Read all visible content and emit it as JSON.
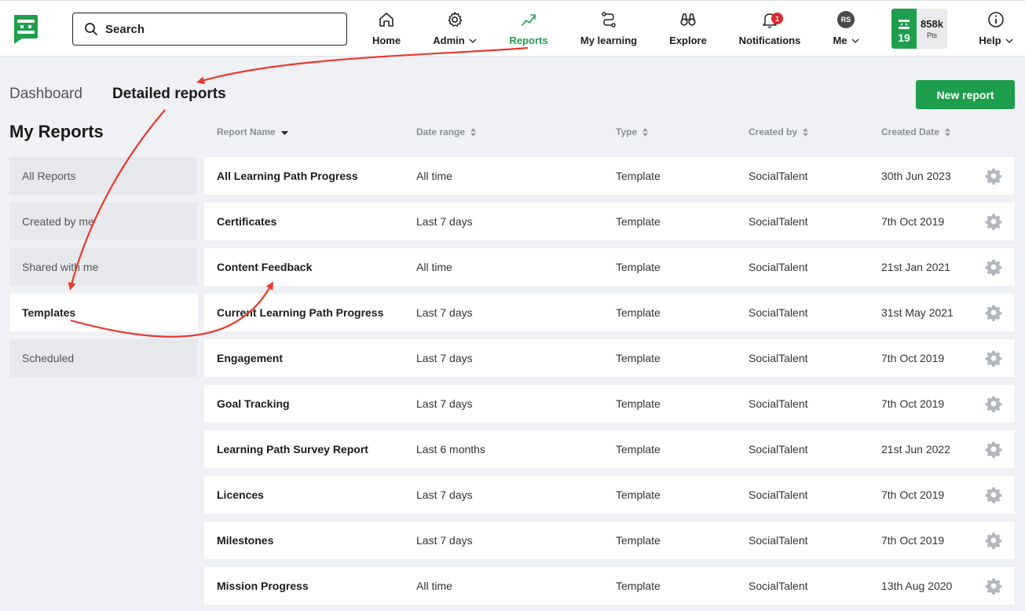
{
  "colors": {
    "brand_green": "#1f9e4d",
    "badge_red": "#e0262f",
    "annotation_red": "#e8392e"
  },
  "search": {
    "placeholder": "Search"
  },
  "nav": {
    "home": "Home",
    "admin": "Admin",
    "reports": "Reports",
    "learning": "My learning",
    "explore": "Explore",
    "notifications": "Notifications",
    "notifications_count": "1",
    "me": "Me",
    "me_initials": "RS",
    "help": "Help"
  },
  "points": {
    "level": "19",
    "value": "858k",
    "label": "Pts"
  },
  "tabs": {
    "dashboard": "Dashboard",
    "detailed": "Detailed reports"
  },
  "new_report_label": "New report",
  "sidebar": {
    "title": "My Reports",
    "items": [
      {
        "label": "All Reports"
      },
      {
        "label": "Created by me"
      },
      {
        "label": "Shared with me"
      },
      {
        "label": "Templates"
      },
      {
        "label": "Scheduled"
      }
    ]
  },
  "table": {
    "headers": {
      "name": "Report Name",
      "date": "Date range",
      "type": "Type",
      "by": "Created by",
      "created": "Created Date"
    },
    "rows": [
      {
        "name": "All Learning Path Progress",
        "date": "All time",
        "type": "Template",
        "by": "SocialTalent",
        "created": "30th Jun 2023"
      },
      {
        "name": "Certificates",
        "date": "Last 7 days",
        "type": "Template",
        "by": "SocialTalent",
        "created": "7th Oct 2019"
      },
      {
        "name": "Content Feedback",
        "date": "All time",
        "type": "Template",
        "by": "SocialTalent",
        "created": "21st Jan 2021"
      },
      {
        "name": "Current Learning Path Progress",
        "date": "Last 7 days",
        "type": "Template",
        "by": "SocialTalent",
        "created": "31st May 2021"
      },
      {
        "name": "Engagement",
        "date": "Last 7 days",
        "type": "Template",
        "by": "SocialTalent",
        "created": "7th Oct 2019"
      },
      {
        "name": "Goal Tracking",
        "date": "Last 7 days",
        "type": "Template",
        "by": "SocialTalent",
        "created": "7th Oct 2019"
      },
      {
        "name": "Learning Path Survey Report",
        "date": "Last 6 months",
        "type": "Template",
        "by": "SocialTalent",
        "created": "21st Jun 2022"
      },
      {
        "name": "Licences",
        "date": "Last 7 days",
        "type": "Template",
        "by": "SocialTalent",
        "created": "7th Oct 2019"
      },
      {
        "name": "Milestones",
        "date": "Last 7 days",
        "type": "Template",
        "by": "SocialTalent",
        "created": "7th Oct 2019"
      },
      {
        "name": "Mission Progress",
        "date": "All time",
        "type": "Template",
        "by": "SocialTalent",
        "created": "13th Aug 2020"
      }
    ]
  }
}
